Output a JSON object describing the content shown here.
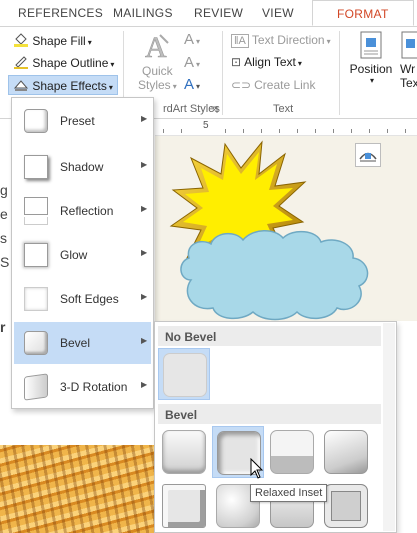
{
  "tabs": [
    {
      "label": "REFERENCES"
    },
    {
      "label": "MAILINGS"
    },
    {
      "label": "REVIEW"
    },
    {
      "label": "VIEW"
    },
    {
      "label": "FORMAT"
    }
  ],
  "ribbon": {
    "shape_fill": "Shape Fill",
    "shape_outline": "Shape Outline",
    "shape_effects": "Shape Effects",
    "quick_styles_line1": "Quick",
    "quick_styles_line2": "Styles",
    "wordart_styles_group": "rdArt Styles",
    "text_direction": "Text Direction",
    "align_text": "Align Text",
    "create_link": "Create Link",
    "text_group": "Text",
    "position": "Position",
    "wrap_text_line1": "Wr",
    "wrap_text_line2": "Tex"
  },
  "ruler": {
    "label_5": "5"
  },
  "document": {
    "fragment_1": "g",
    "fragment_2": "e",
    "fragment_3": "s",
    "fragment_4": "S",
    "fragment_5": "r"
  },
  "effects_menu": {
    "items": [
      {
        "label": "Preset"
      },
      {
        "label": "Shadow"
      },
      {
        "label": "Reflection"
      },
      {
        "label": "Glow"
      },
      {
        "label": "Soft Edges"
      },
      {
        "label": "Bevel"
      },
      {
        "label": "3-D Rotation"
      }
    ],
    "selected": "Bevel"
  },
  "bevel_gallery": {
    "no_bevel_header": "No Bevel",
    "bevel_header": "Bevel",
    "tooltip": "Relaxed Inset"
  },
  "colors": {
    "accent": "#d24726",
    "selection": "#c5dcf6",
    "sun": "#ffee00",
    "cloud": "#a8d8e8"
  }
}
